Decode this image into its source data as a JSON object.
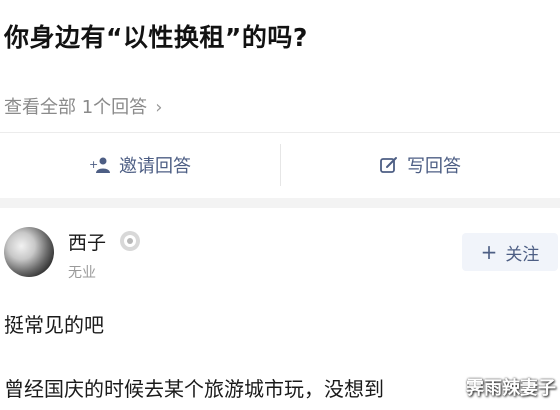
{
  "question": {
    "title": "你身边有“以性换租”的吗?",
    "view_all": "查看全部 1个回答"
  },
  "actions": {
    "invite_label": "邀请回答",
    "write_label": "写回答"
  },
  "answer": {
    "author_name": "西子",
    "author_desc": "无业",
    "follow_label": "关注",
    "line1": "挺常见的吧",
    "line2": "曾经国庆的时候去某个旅游城市玩，没想到"
  },
  "watermark": "霁雨辣妻子",
  "colors": {
    "accent": "#4d5e84",
    "muted_text": "#8a8a8a",
    "follow_bg": "#f1f4fa",
    "section_gap": "#f3f3f3"
  },
  "icons": {
    "chevron": "chevron-right-icon",
    "invite": "invite-user-icon",
    "write": "edit-icon",
    "badge": "verified-badge-icon",
    "follow": "plus-icon"
  }
}
